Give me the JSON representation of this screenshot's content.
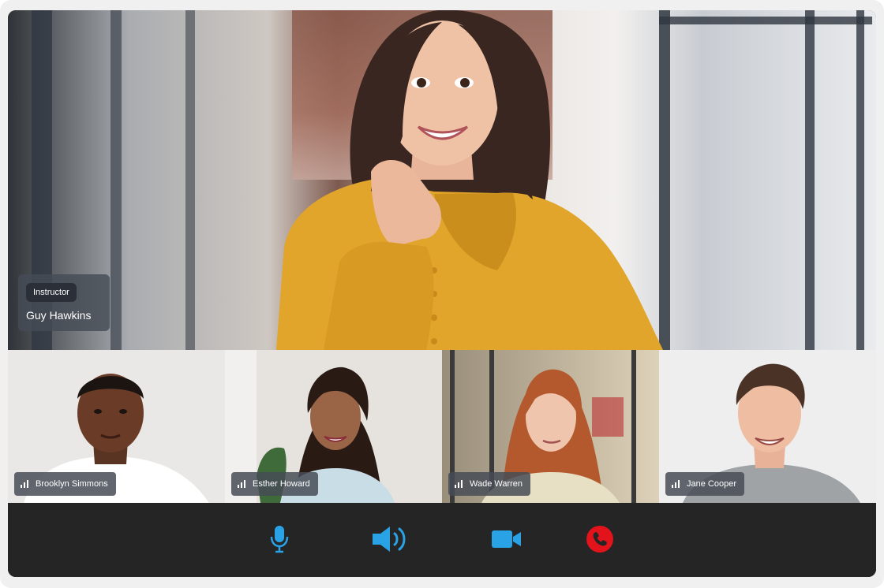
{
  "main": {
    "role_label": "Instructor",
    "name": "Guy Hawkins"
  },
  "participants": [
    {
      "name": "Brooklyn Simmons"
    },
    {
      "name": "Esther Howard"
    },
    {
      "name": "Wade Warren"
    },
    {
      "name": "Jane Cooper"
    }
  ],
  "controls": [
    {
      "icon": "microphone-icon",
      "color": "#2aa3e6"
    },
    {
      "icon": "speaker-icon",
      "color": "#2aa3e6"
    },
    {
      "icon": "video-camera-icon",
      "color": "#2aa3e6"
    },
    {
      "icon": "end-call-icon",
      "color": "#e3131b"
    }
  ],
  "colors": {
    "accent": "#2aa3e6",
    "end_call": "#e3131b",
    "control_bar": "#252525",
    "shirt_main": "#e0a52a"
  }
}
